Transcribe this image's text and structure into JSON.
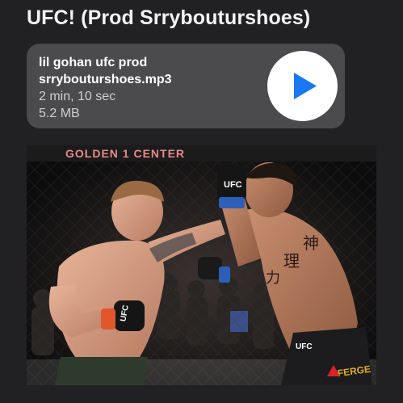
{
  "post": {
    "title": "UFC! (Prod Srrybouturshoes)"
  },
  "audio": {
    "filename": "lil gohan ufc prod srrybouturshoes.mp3",
    "duration": "2 min, 10 sec",
    "size": "5.2 MB",
    "play_icon": "play-icon",
    "accent_color": "#1a78f2"
  },
  "photo": {
    "arena_banner": "GOLDEN 1 CENTER",
    "glove_brand": "UFC",
    "shorts_brand": "UFC",
    "trunk_sponsor": "FERGE",
    "tattoo_chars": [
      "神",
      "理",
      "力"
    ]
  }
}
